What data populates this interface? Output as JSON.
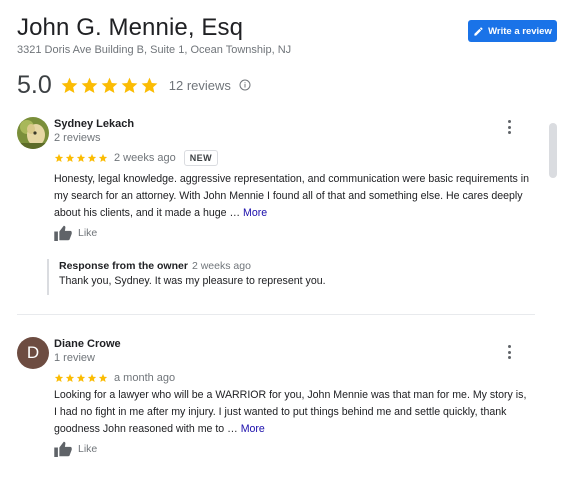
{
  "business": {
    "name": "John G. Mennie, Esq",
    "address": "3321 Doris Ave Building B, Suite 1, Ocean Township, NJ"
  },
  "write_review_button": {
    "label": "Write a review",
    "icon": "pencil-icon"
  },
  "summary": {
    "score": "5.0",
    "stars": 5,
    "reviews_label": "12 reviews",
    "info_icon": "info-icon"
  },
  "colors": {
    "star": "#fbbc04",
    "accent": "#1a73e8",
    "link": "#1a0dab"
  },
  "reviews": [
    {
      "name": "Sydney Lekach",
      "subtitle": "2 reviews",
      "stars": 5,
      "time": "2 weeks ago",
      "badge": "NEW",
      "text": "Honesty, legal knowledge. aggressive representation, and communication were basic requirements in my search for an attorney.  With John Mennie I found all of that and something else.  He cares deeply about his clients, and it made a huge … ",
      "more": "More",
      "like": "Like",
      "owner_response": {
        "label": "Response from the owner",
        "time": "2 weeks ago",
        "text": "Thank you, Sydney. It was my pleasure to represent you."
      }
    },
    {
      "name": "Diane Crowe",
      "avatar_letter": "D",
      "avatar_color": "#6d4c41",
      "subtitle": "1 review",
      "stars": 5,
      "time": "a month ago",
      "text": "Looking for a lawyer who will be a WARRIOR  for you, John Mennie was that man for me. My story is, I had no fight in me after my injury. I just wanted to put things behind me and settle quickly,  thank goodness John  reasoned with me to … ",
      "more": "More",
      "like": "Like"
    }
  ]
}
